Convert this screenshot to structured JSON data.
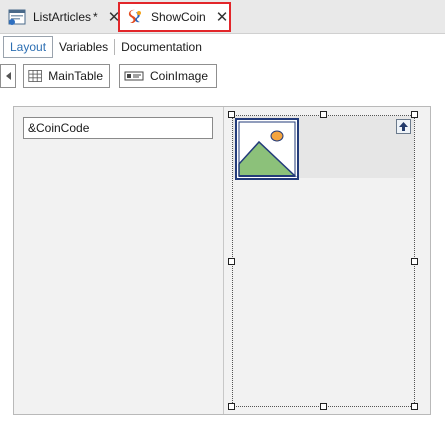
{
  "doc_tabs": [
    {
      "label": "ListArticles",
      "modified": "*",
      "close": "✕"
    },
    {
      "label": "ShowCoin",
      "close": "✕"
    }
  ],
  "view_tabs": [
    {
      "label": "Layout",
      "active": true
    },
    {
      "label": "Variables"
    },
    {
      "label": "Documentation"
    }
  ],
  "breadcrumb": [
    {
      "label": "MainTable",
      "icon": "table-grid-icon"
    },
    {
      "label": "CoinImage",
      "icon": "image-control-icon"
    }
  ],
  "canvas": {
    "textbox_value": "&CoinCode"
  },
  "colors": {
    "active_tab_border": "#e2262a",
    "active_view_text": "#2d6fb3",
    "canvas_bg": "#f2f2f2"
  }
}
